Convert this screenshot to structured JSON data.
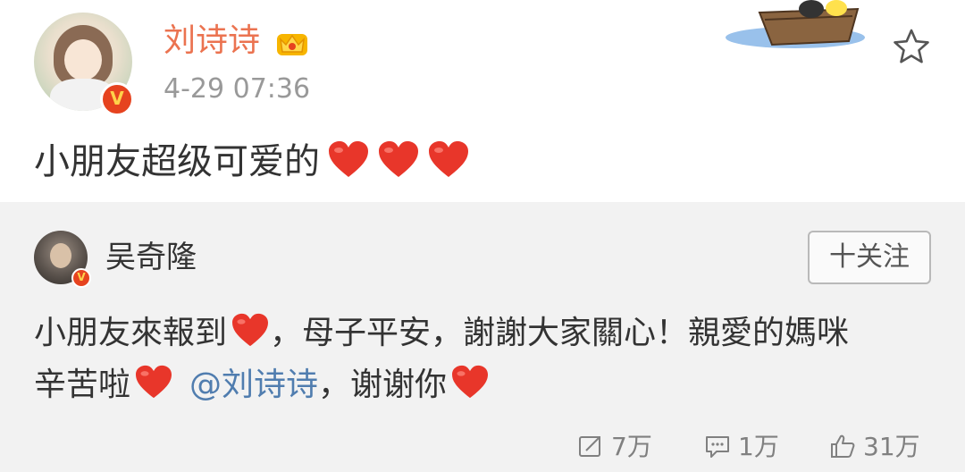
{
  "post": {
    "username": "刘诗诗",
    "timestamp": "4-29 07:36",
    "text": "小朋友超级可爱的"
  },
  "repost": {
    "username": "吴奇隆",
    "follow_label": "十关注",
    "text_line1": "小朋友來報到",
    "text_line1_b": "，母子平安，謝謝大家關心！親愛的媽咪",
    "text_line2": "辛苦啦",
    "mention": "@刘诗诗",
    "text_line2_end": "，谢谢你"
  },
  "actions": {
    "reposts": "7万",
    "comments": "1万",
    "likes": "31万"
  },
  "icons": {
    "verified_badge": "v-badge-icon",
    "vip_crown": "crown-icon",
    "favorite": "star-icon",
    "heart": "heart-icon",
    "repost": "repost-icon",
    "comment": "comment-icon",
    "like": "thumbs-up-icon"
  },
  "colors": {
    "username": "#eb7350",
    "mention": "#507daf",
    "heart": "#e8362a",
    "repost_background": "#f2f2f2"
  }
}
